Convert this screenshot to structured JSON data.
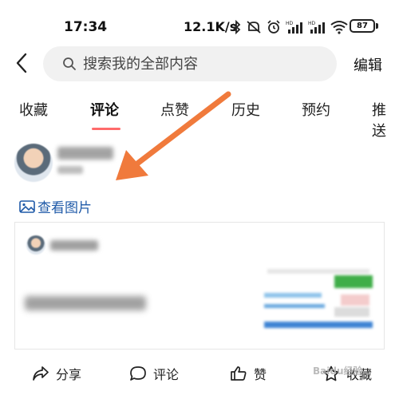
{
  "status_bar": {
    "time": "17:34",
    "network_speed": "12.1K/s",
    "battery": "87",
    "icons": [
      "bluetooth-icon",
      "mute-icon",
      "alarm-icon",
      "hd-signal-icon",
      "hd-signal-icon",
      "wifi-icon",
      "battery-icon"
    ]
  },
  "header": {
    "back_icon": "chevron-left-icon",
    "search_placeholder": "搜索我的全部内容",
    "search_value": "",
    "edit_label": "编辑"
  },
  "tabs": [
    {
      "label": "收藏",
      "active": false
    },
    {
      "label": "评论",
      "active": true
    },
    {
      "label": "点赞",
      "active": false
    },
    {
      "label": "历史",
      "active": false
    },
    {
      "label": "预约",
      "active": false
    },
    {
      "label": "推送",
      "active": false
    }
  ],
  "comment": {
    "view_images_label": "查看图片"
  },
  "actions": {
    "share": "分享",
    "comment": "评论",
    "like": "赞",
    "favorite": "收藏"
  },
  "annotation": {
    "arrow_color": "#f07a3c"
  },
  "watermark": "Baidu经验",
  "colors": {
    "active_tab_underline": "#ff6b6b",
    "link_blue": "#1f5aa8",
    "search_bg": "#f1f1f1"
  }
}
